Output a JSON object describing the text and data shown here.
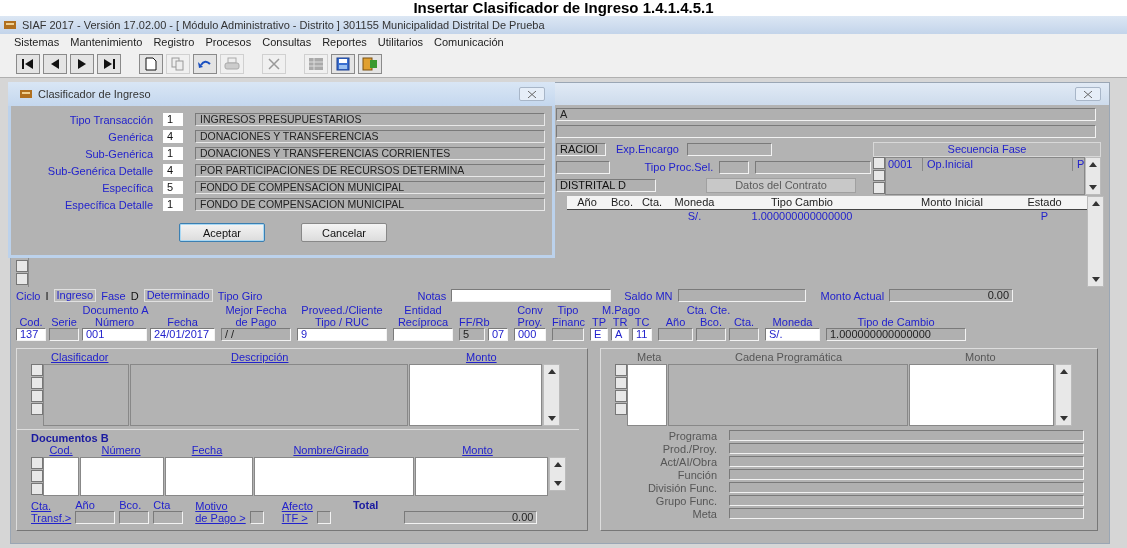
{
  "heading": "Insertar Clasificador de Ingreso 1.4.1.4.5.1",
  "window": {
    "title": "SIAF 2017 - Versión 17.02.00 - [ Módulo Administrativo - Distrito ] 301155 Municipalidad Distrital De Prueba"
  },
  "menu": [
    "Sistemas",
    "Mantenimiento",
    "Registro",
    "Procesos",
    "Consultas",
    "Reportes",
    "Utilitarios",
    "Comunicación"
  ],
  "toolbar": [
    {
      "kind": "first",
      "disabled": false
    },
    {
      "kind": "previous",
      "disabled": false
    },
    {
      "kind": "next",
      "disabled": false
    },
    {
      "kind": "last",
      "disabled": false
    },
    {
      "kind": "new",
      "disabled": false
    },
    {
      "kind": "copy",
      "disabled": true
    },
    {
      "kind": "undo",
      "disabled": false
    },
    {
      "kind": "print",
      "disabled": true
    },
    {
      "kind": "delete",
      "disabled": true
    },
    {
      "kind": "grid",
      "disabled": true
    },
    {
      "kind": "save",
      "disabled": false
    },
    {
      "kind": "exit",
      "disabled": false
    }
  ],
  "form": {
    "entity_field": "A",
    "expediente": {
      "field_1": "RACIOI",
      "encargo_label": "Exp.Encargo",
      "proc_label": "Tipo Proc.Sel.",
      "field_3": "DISTRITAL D",
      "contract_button": {
        "label": "Datos del Contrato",
        "disabled": true
      }
    },
    "sequence": {
      "title": "Secuencia Fase",
      "rows": [
        {
          "cells": [
            "0001",
            "Op.Inicial",
            "P"
          ]
        }
      ]
    },
    "grid": {
      "columns": [
        "Año",
        "Bco.",
        "Cta.",
        "Moneda",
        "Tipo Cambio",
        "Monto Inicial",
        "Estado"
      ],
      "rows": [
        {
          "cells": [
            null,
            null,
            null,
            "S/.",
            "1.000000000000000",
            null,
            "P"
          ]
        }
      ]
    },
    "phase": {
      "ciclo_label": "Ciclo",
      "ciclo": "I",
      "ciclo_name": "Ingreso",
      "fase_label": "Fase",
      "fase": "D",
      "fase_name": "Determinado",
      "giro_label": "Tipo Giro",
      "notas_label": "Notas",
      "saldo_label": "Saldo MN",
      "monto_label": "Monto Actual",
      "monto": "0.00"
    },
    "doc_groups": [
      {
        "title": "Documento A",
        "cols": [
          {
            "label": "Cod.",
            "value": "137",
            "editable": true
          },
          {
            "label": "Serie",
            "editable": false
          },
          {
            "label": "Número",
            "value": "001",
            "editable": true
          },
          {
            "label": "Fecha",
            "value": "24/01/2017",
            "editable": true
          }
        ]
      },
      {
        "title": "Mejor Fecha",
        "cols": [
          {
            "label": "de Pago",
            "value": "/ /",
            "editable": false
          }
        ]
      },
      {
        "title": "Proveed./Cliente",
        "cols": [
          {
            "label": "Tipo / RUC",
            "value": "9",
            "editable": true
          }
        ]
      },
      {
        "title": "Entidad",
        "cols": [
          {
            "label": "Recíproca",
            "editable": true
          }
        ]
      },
      {
        "cols": [
          {
            "label": "FF/Rb",
            "value": "5",
            "editable": false
          },
          {
            "value": "07",
            "editable": true
          }
        ]
      },
      {
        "title": "Conv",
        "cols": [
          {
            "label": "Proy.",
            "value": "000",
            "editable": true
          }
        ]
      },
      {
        "title": "Tipo",
        "cols": [
          {
            "label": "Financ",
            "editable": false
          }
        ]
      },
      {
        "title": "M.Pago",
        "cols": [
          {
            "label": "TP",
            "value": "E",
            "editable": true
          },
          {
            "label": "TR",
            "value": "A",
            "editable": true
          },
          {
            "label": "TC",
            "value": "11",
            "editable": true
          }
        ]
      },
      {
        "title": "Cta. Cte.",
        "cols": [
          {
            "label": "Año",
            "editable": false
          },
          {
            "label": "Bco.",
            "editable": false
          },
          {
            "label": "Cta.",
            "editable": false
          }
        ]
      },
      {
        "cols": [
          {
            "label": "Moneda",
            "value": "S/.",
            "editable": true
          }
        ]
      },
      {
        "cols": [
          {
            "label": "Tipo de Cambio",
            "value": "1.000000000000000",
            "editable": false
          }
        ]
      }
    ],
    "detail": {
      "columns": [
        "Clasificador",
        "Descripción",
        "Monto"
      ]
    },
    "documents_b": {
      "title": "Documentos B",
      "columns": [
        "Cod.",
        "Número",
        "Fecha",
        "Nombre/Girado",
        "Monto"
      ],
      "footer": {
        "transfer_link": [
          "Cta.",
          "Transf.>"
        ],
        "year_label": "Año",
        "bank_label": "Bco.",
        "account_label": "Cta",
        "motive_link": [
          "Motivo",
          "de Pago >"
        ],
        "itf_link": [
          "Afecto",
          "ITF >"
        ],
        "total_label": "Total",
        "total": "0.00"
      }
    },
    "budget": {
      "disabled": true,
      "columns": [
        "Meta",
        "Cadena Programática",
        "Monto"
      ],
      "fields": [
        "Programa",
        "Prod./Proy.",
        "Act/AI/Obra",
        "Función",
        "División Func.",
        "Grupo Func.",
        "Meta"
      ]
    }
  },
  "dialog": {
    "title": "Clasificador de Ingreso",
    "rows": [
      {
        "label": "Tipo Transacción",
        "code": "1",
        "description": "INGRESOS PRESUPUESTARIOS"
      },
      {
        "label": "Genérica",
        "code": "4",
        "description": "DONACIONES Y TRANSFERENCIAS"
      },
      {
        "label": "Sub-Genérica",
        "code": "1",
        "description": "DONACIONES Y TRANSFERENCIAS CORRIENTES"
      },
      {
        "label": "Sub-Genérica Detalle",
        "code": "4",
        "description": "POR PARTICIPACIONES DE RECURSOS DETERMINA"
      },
      {
        "label": "Específica",
        "code": "5",
        "description": "FONDO DE COMPENSACION MUNICIPAL"
      },
      {
        "label": "Específica Detalle",
        "code": "1",
        "description": "FONDO DE COMPENSACION MUNICIPAL"
      }
    ],
    "buttons": [
      {
        "label": "Aceptar",
        "focused": true
      },
      {
        "label": "Cancelar",
        "focused": false
      }
    ]
  }
}
